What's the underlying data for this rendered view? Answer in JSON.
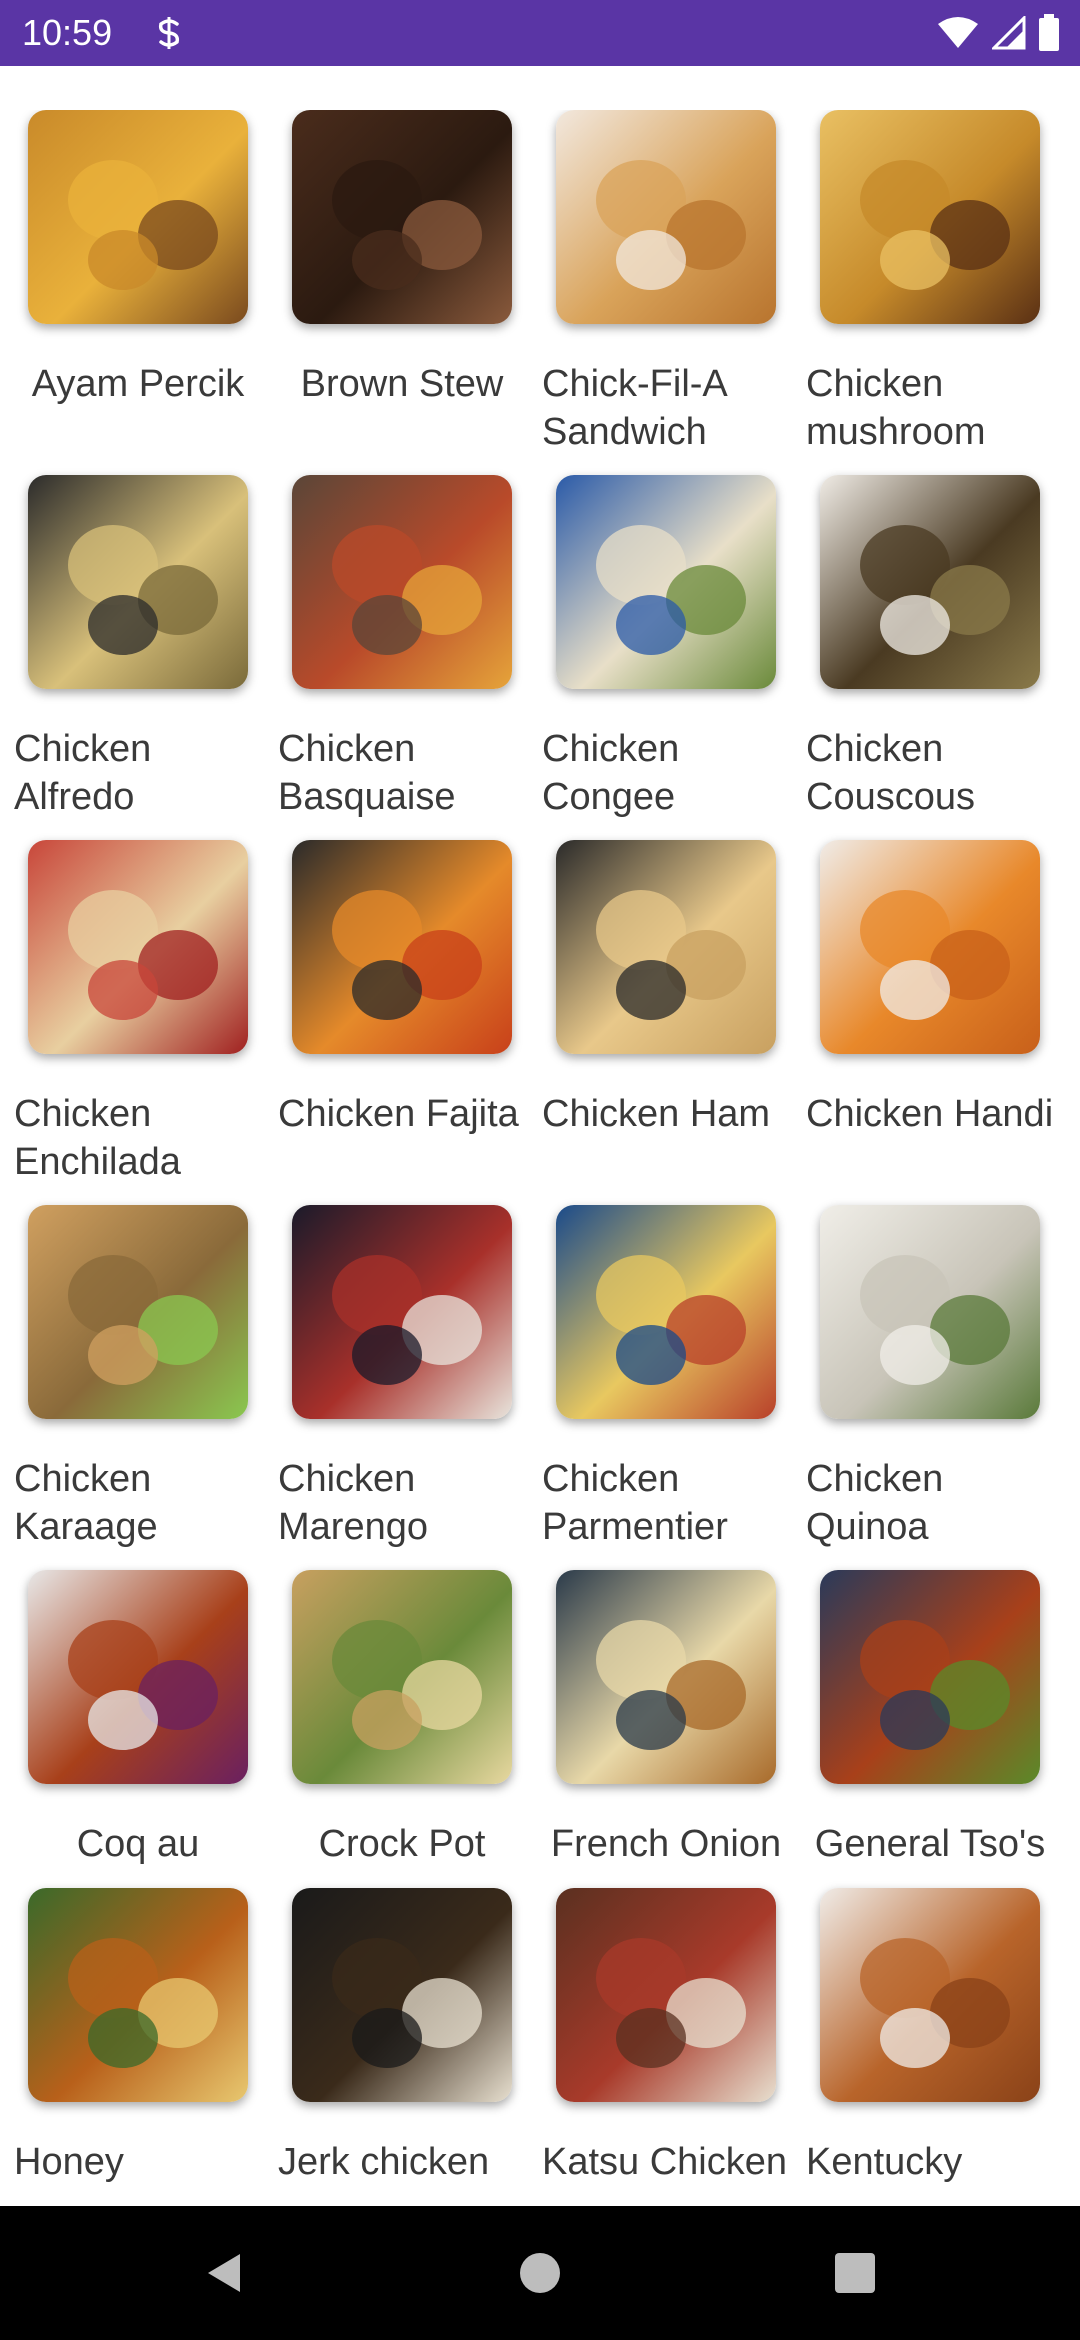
{
  "status_bar": {
    "time": "10:59",
    "app_icon": "s-notification-icon",
    "icons": [
      "wifi-icon",
      "signal-icon",
      "battery-icon"
    ],
    "background": "#5a35a5"
  },
  "recipes": [
    {
      "name": "Ayam Percik",
      "colors": [
        "#c98a2a",
        "#e9b13b",
        "#7a4a1e"
      ]
    },
    {
      "name": "Brown Stew",
      "colors": [
        "#4a2c1c",
        "#2b1a10",
        "#8a5a3c"
      ]
    },
    {
      "name": "Chick-Fil-A Sandwich",
      "colors": [
        "#f2e8de",
        "#d9a35a",
        "#b8742e"
      ]
    },
    {
      "name": "Chicken mushroom",
      "colors": [
        "#e9c063",
        "#c68a2a",
        "#5a3014"
      ]
    },
    {
      "name": "Chicken Alfredo",
      "colors": [
        "#2b2b2b",
        "#d8c07a",
        "#7a6a3a"
      ]
    },
    {
      "name": "Chicken Basquaise",
      "colors": [
        "#5a4638",
        "#b94a2a",
        "#e6a43a"
      ]
    },
    {
      "name": "Chicken Congee",
      "colors": [
        "#2a5aa8",
        "#e8dfc8",
        "#6a8a3a"
      ]
    },
    {
      "name": "Chicken Couscous",
      "colors": [
        "#f0ece6",
        "#4a3a22",
        "#8a7a4a"
      ]
    },
    {
      "name": "Chicken Enchilada",
      "colors": [
        "#c8463a",
        "#e8cfa0",
        "#a02020"
      ]
    },
    {
      "name": "Chicken Fajita",
      "colors": [
        "#2a2a2a",
        "#e58a2a",
        "#c8401a"
      ]
    },
    {
      "name": "Chicken Ham",
      "colors": [
        "#2a2a2a",
        "#e8c88a",
        "#c8a060"
      ]
    },
    {
      "name": "Chicken Handi",
      "colors": [
        "#f0ece8",
        "#e8882a",
        "#c8601a"
      ]
    },
    {
      "name": "Chicken Karaage",
      "colors": [
        "#d0a060",
        "#8a6a3a",
        "#8ac850"
      ]
    },
    {
      "name": "Chicken Marengo",
      "colors": [
        "#1a1a2a",
        "#a8302a",
        "#e8e4dc"
      ]
    },
    {
      "name": "Chicken Parmentier",
      "colors": [
        "#1a4a8a",
        "#e8c860",
        "#b8402a"
      ]
    },
    {
      "name": "Chicken Quinoa",
      "colors": [
        "#f0eee8",
        "#c8c4b8",
        "#5a7a3a"
      ]
    },
    {
      "name": "Coq au",
      "colors": [
        "#e8e8e8",
        "#a8401a",
        "#6a2060"
      ]
    },
    {
      "name": "Crock Pot",
      "colors": [
        "#c8a060",
        "#6a8a3a",
        "#e8d8a0"
      ]
    },
    {
      "name": "French Onion",
      "colors": [
        "#2a3a4a",
        "#e8d8a8",
        "#a86a2a"
      ]
    },
    {
      "name": "General Tso's",
      "colors": [
        "#2a3a5a",
        "#a8401a",
        "#5a8a2a"
      ]
    },
    {
      "name": "Honey",
      "colors": [
        "#3a6a2a",
        "#b8601a",
        "#e8c870"
      ]
    },
    {
      "name": "Jerk chicken",
      "colors": [
        "#1a1a1a",
        "#3a2a1a",
        "#e8e0d0"
      ]
    },
    {
      "name": "Katsu Chicken",
      "colors": [
        "#5a3020",
        "#a83a2a",
        "#e8e0d0"
      ]
    },
    {
      "name": "Kentucky",
      "colors": [
        "#f0ece8",
        "#b8642a",
        "#8a4218"
      ]
    }
  ],
  "nav_bar": {
    "back": "back-icon",
    "home": "home-icon",
    "recents": "recents-icon"
  }
}
